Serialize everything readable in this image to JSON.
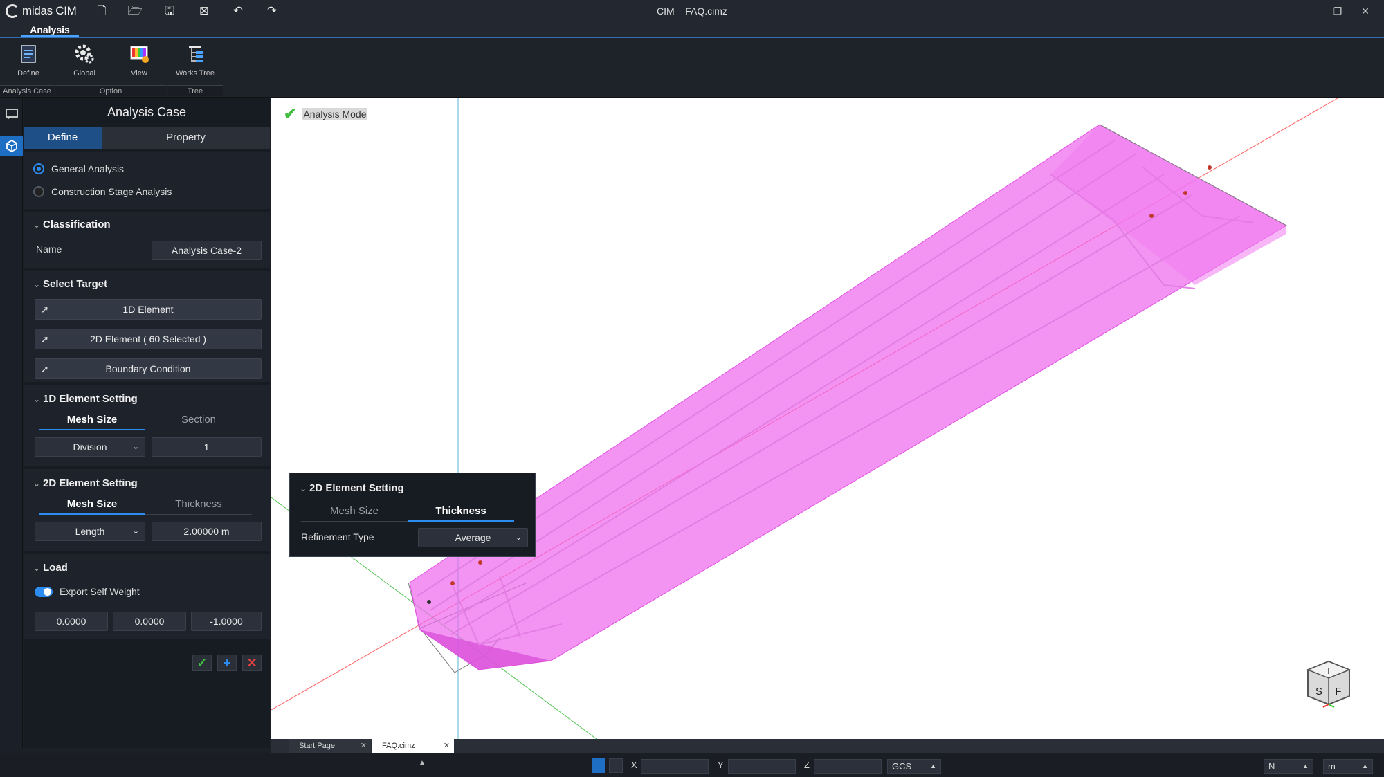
{
  "app": {
    "brand": "midas CIM",
    "window_title": "CIM – FAQ.cimz"
  },
  "ribbon": {
    "tab": "Analysis",
    "buttons": [
      "Define",
      "Global",
      "View",
      "Works Tree"
    ],
    "groups": [
      "Analysis Case",
      "Option",
      "Tree"
    ]
  },
  "panel": {
    "title": "Analysis Case",
    "tabs": [
      "Define",
      "Property"
    ],
    "analysis_types": [
      "General Analysis",
      "Construction Stage Analysis"
    ],
    "classification": {
      "header": "Classification",
      "name_label": "Name",
      "name_value": "Analysis Case-2"
    },
    "select_target": {
      "header": "Select Target",
      "items": [
        "1D Element",
        "2D Element ( 60 Selected )",
        "Boundary Condition"
      ]
    },
    "element_1d": {
      "header": "1D Element Setting",
      "tabs": [
        "Mesh Size",
        "Section"
      ],
      "method": "Division",
      "value": "1"
    },
    "element_2d": {
      "header": "2D Element Setting",
      "tabs": [
        "Mesh Size",
        "Thickness"
      ],
      "method": "Length",
      "value": "2.00000 m"
    },
    "load": {
      "header": "Load",
      "toggle_label": "Export Self Weight",
      "values": [
        "0.0000",
        "0.0000",
        "-1.0000"
      ]
    }
  },
  "viewport": {
    "mode_label": "Analysis Mode"
  },
  "popup": {
    "header": "2D Element Setting",
    "tabs": [
      "Mesh Size",
      "Thickness"
    ],
    "refinement_label": "Refinement Type",
    "refinement_value": "Average"
  },
  "doc_tabs": [
    "Start Page",
    "FAQ.cimz"
  ],
  "status": {
    "coord_labels": [
      "X",
      "Y",
      "Z"
    ],
    "coord_system": "GCS",
    "force_unit": "N",
    "length_unit": "m"
  },
  "colors": {
    "accent": "#2d8cf0",
    "model": "#ee66ee",
    "ok": "#3fbf3f",
    "cancel": "#e04040"
  }
}
